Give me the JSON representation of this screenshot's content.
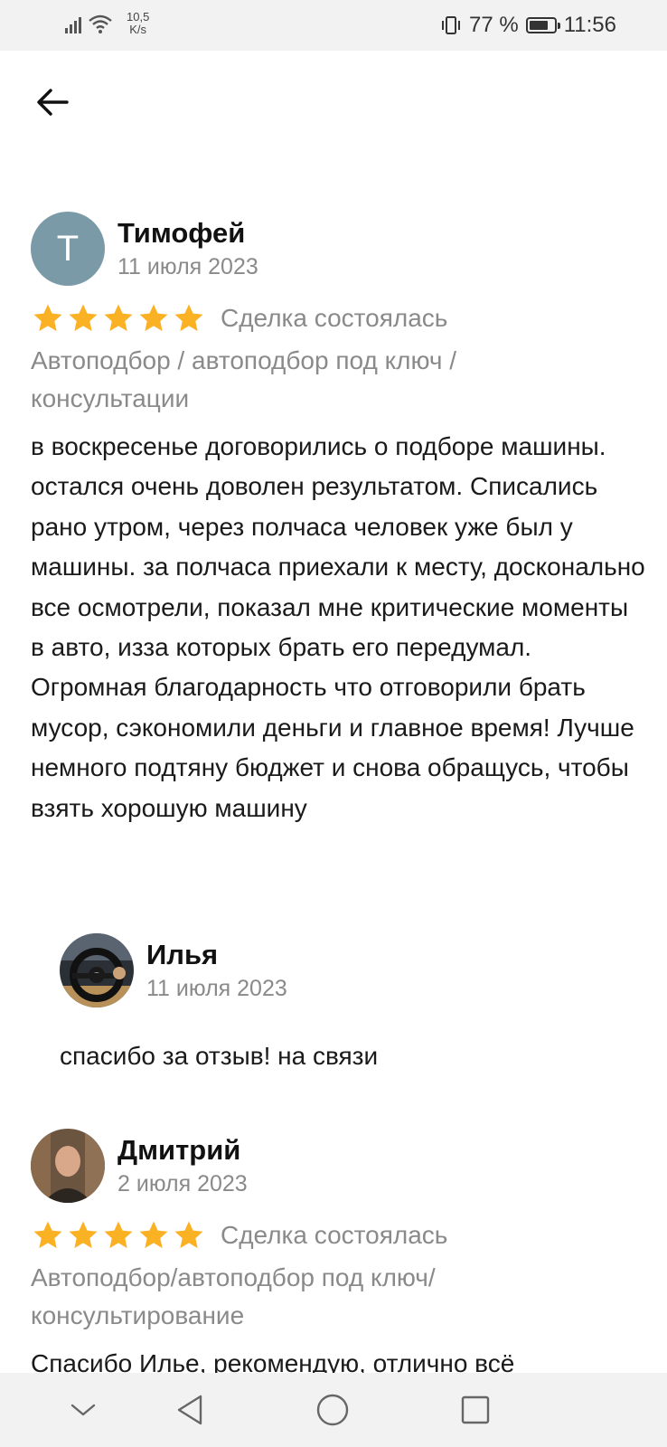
{
  "status_bar": {
    "speed_value": "10,5",
    "speed_unit": "K/s",
    "battery": "77 %",
    "battery_level": 0.77,
    "time": "11:56"
  },
  "icons": {
    "back": "arrow-left-icon",
    "star": "star-icon",
    "nav_collapse": "chevron-down-icon",
    "nav_back": "triangle-back-icon",
    "nav_home": "circle-home-icon",
    "nav_recents": "square-recents-icon"
  },
  "colors": {
    "star": "#fbb124",
    "secondary_text": "#8a8a8a",
    "avatar_letter_bg": "#7b9aa7"
  },
  "reviews": [
    {
      "avatar_letter": "Т",
      "author": "Тимофей",
      "date": "11 июля 2023",
      "rating": 5,
      "deal_status": "Сделка состоялась",
      "category": "Автоподбор / автоподбор под ключ / консультации",
      "text": "в воскресенье договорились о подборе машины. остался очень доволен результатом. Списались рано утром, через полчаса человек уже был у машины. за полчаса приехали к месту, досконально все осмотрели, показал мне критические моменты в авто, изза которых брать его передумал. Огромная благодарность что отговорили брать мусор, сэкономили деньги и главное время! Лучше немного подтяну бюджет и снова обращусь, чтобы взять хорошую машину",
      "reply": {
        "author": "Илья",
        "date": "11 июля 2023",
        "text": "спасибо за отзыв! на связи"
      }
    },
    {
      "author": "Дмитрий",
      "date": "2 июля 2023",
      "rating": 5,
      "deal_status": "Сделка состоялась",
      "category": "Автоподбор/автоподбор под ключ/ консультирование",
      "text": "Спасибо Илье, рекомендую, отлично всё"
    }
  ]
}
